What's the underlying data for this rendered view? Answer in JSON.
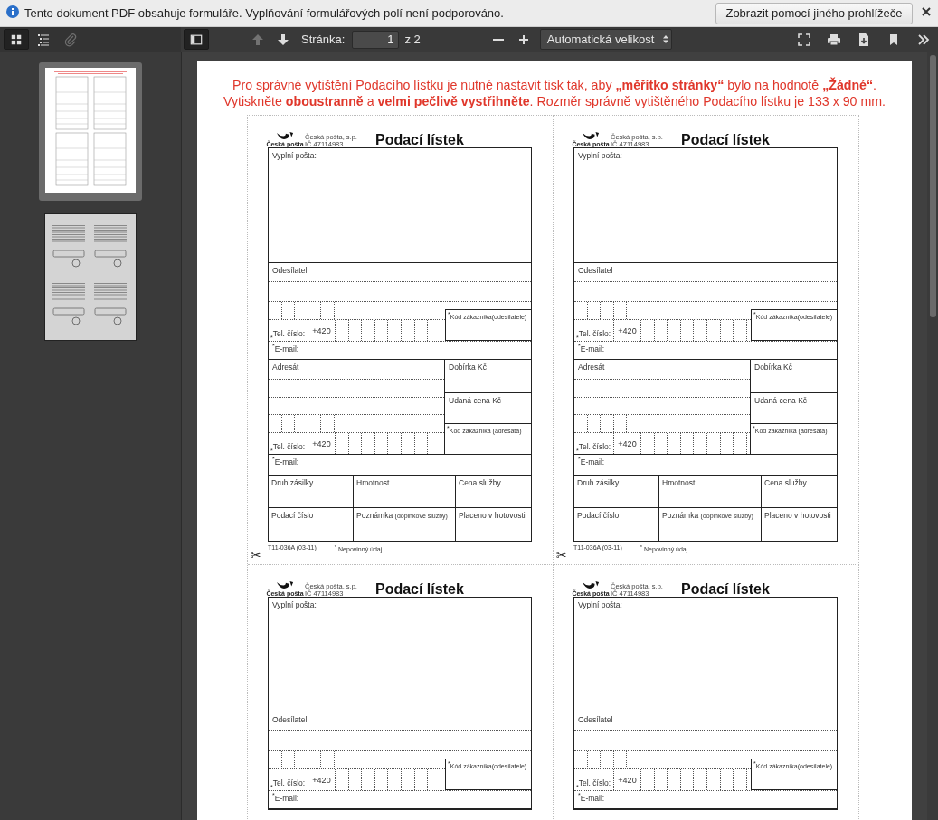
{
  "infobar": {
    "message": "Tento dokument PDF obsahuje formuláře. Vyplňování formulářových polí není podporováno.",
    "button": "Zobrazit pomocí jiného prohlížeče"
  },
  "toolbar": {
    "sidebar_views": [
      {
        "kind": "thumbnails",
        "selected": true,
        "disabled": false
      },
      {
        "kind": "outline",
        "selected": false,
        "disabled": false
      },
      {
        "kind": "attachments",
        "selected": false,
        "disabled": true
      }
    ],
    "sidebar_toggle": {
      "on": true
    },
    "nav": [
      {
        "kind": "previous",
        "disabled": true
      },
      {
        "kind": "next",
        "disabled": false
      }
    ],
    "page_label": "Stránka:",
    "page_number": "1",
    "page_count": "z 2",
    "zoom": [
      {
        "kind": "zoom-out"
      },
      {
        "kind": "zoom-in"
      }
    ],
    "zoom_select": "Automatická velikost",
    "tools": [
      {
        "kind": "presentation"
      },
      {
        "kind": "print"
      },
      {
        "kind": "download"
      },
      {
        "kind": "bookmark"
      },
      {
        "kind": "more"
      }
    ]
  },
  "thumbnails": [
    {
      "kind": "forms",
      "selected": true
    },
    {
      "kind": "instructions",
      "selected": false
    }
  ],
  "page": {
    "notice": [
      "Pro správné vytištění Podacího lístku je nutné nastavit tisk tak, aby **„měřítko stránky“** bylo na hodnotě **„Žádné“**.",
      "Vytiskněte **oboustranně** a **velmi pečlivě vystřihněte**. Rozměr správně vytištěného Podacího lístku je 133 x 90 mm."
    ],
    "forms": [
      {
        "logo_caption": "Česká pošta",
        "company": "Česká pošta, s.p.",
        "ic": "IČ 47114983",
        "title": "Podací lístek",
        "post_label": "Vyplní pošta:",
        "sender": {
          "label": "Odesílatel",
          "phone_label": "$^{*}$Tel. číslo:",
          "phone_prefix": "+420",
          "code_label": "$^{*}$Kód zákazníka(odesílatele)",
          "email_label": "$^{*}$E-mail:"
        },
        "recipient": {
          "label": "Adresát",
          "cod_label": "Dobírka Kč",
          "value_label": "Udaná cena Kč",
          "phone_label": "$^{*}$Tel. číslo:",
          "phone_prefix": "+420",
          "code_label": "$^{*}$Kód zákazníka (adresáta)",
          "email_label": "$^{*}$E-mail:"
        },
        "grid": [
          {
            "label": "Druh zásilky"
          },
          {
            "label": "Hmotnost"
          },
          {
            "label": "Cena služby"
          },
          {
            "label": "Podací číslo"
          },
          {
            "label": "Poznámka",
            "note": "(doplňkové služby)"
          },
          {
            "label": "Placeno v hotovosti"
          }
        ],
        "footer": {
          "code": "T11-036A (03-11)",
          "legend": "$^{*}$ Nepovinný údaj"
        },
        "cut_mark": "✂"
      },
      {
        "logo_caption": "Česká pošta",
        "company": "Česká pošta, s.p.",
        "ic": "IČ 47114983",
        "title": "Podací lístek",
        "post_label": "Vyplní pošta:",
        "sender": {
          "label": "Odesílatel",
          "phone_label": "$^{*}$Tel. číslo:",
          "phone_prefix": "+420",
          "code_label": "$^{*}$Kód zákazníka(odesílatele)",
          "email_label": "$^{*}$E-mail:"
        },
        "recipient": {
          "label": "Adresát",
          "cod_label": "Dobírka Kč",
          "value_label": "Udaná cena Kč",
          "phone_label": "$^{*}$Tel. číslo:",
          "phone_prefix": "+420",
          "code_label": "$^{*}$Kód zákazníka (adresáta)",
          "email_label": "$^{*}$E-mail:"
        },
        "grid": [
          {
            "label": "Druh zásilky"
          },
          {
            "label": "Hmotnost"
          },
          {
            "label": "Cena služby"
          },
          {
            "label": "Podací číslo"
          },
          {
            "label": "Poznámka",
            "note": "(doplňkové služby)"
          },
          {
            "label": "Placeno v hotovosti"
          }
        ],
        "footer": {
          "code": "T11-036A (03-11)",
          "legend": "$^{*}$ Nepovinný údaj"
        },
        "cut_mark": "✂"
      },
      {
        "logo_caption": "Česká pošta",
        "company": "Česká pošta, s.p.",
        "ic": "IČ 47114983",
        "title": "Podací lístek",
        "post_label": "Vyplní pošta:",
        "sender": {
          "label": "Odesílatel",
          "phone_label": "$^{*}$Tel. číslo:",
          "phone_prefix": "+420",
          "code_label": "$^{*}$Kód zákazníka(odesílatele)",
          "email_label": "$^{*}$E-mail:"
        }
      },
      {
        "logo_caption": "Česká pošta",
        "company": "Česká pošta, s.p.",
        "ic": "IČ 47114983",
        "title": "Podací lístek",
        "post_label": "Vyplní pošta:",
        "sender": {
          "label": "Odesílatel",
          "phone_label": "$^{*}$Tel. číslo:",
          "phone_prefix": "+420",
          "code_label": "$^{*}$Kód zákazníka(odesílatele)",
          "email_label": "$^{*}$E-mail:"
        }
      }
    ]
  }
}
